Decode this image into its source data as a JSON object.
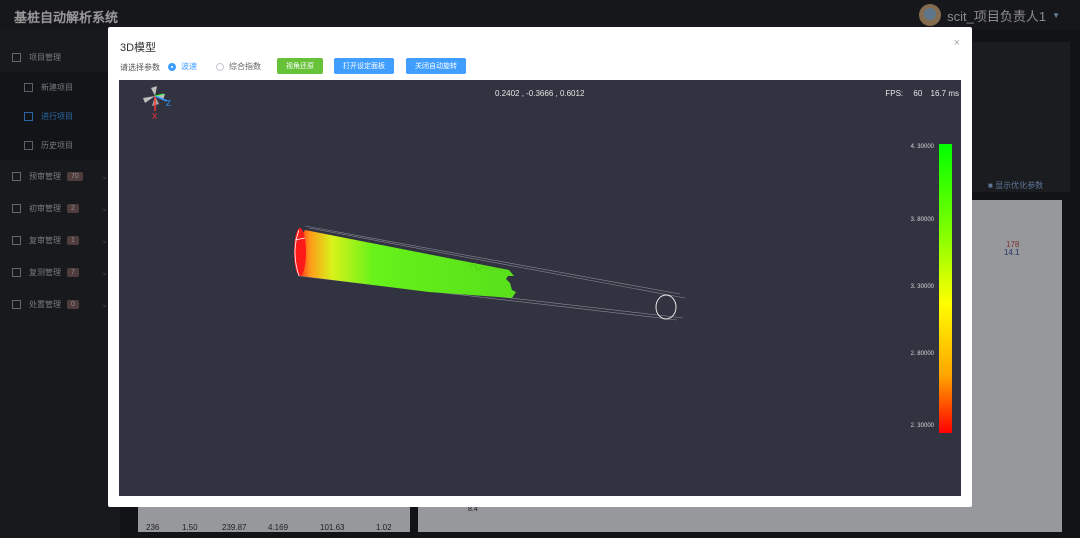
{
  "app": {
    "title": "基桩自动解析系统",
    "user": "scit_项目负责人1"
  },
  "sidebar": {
    "items": [
      {
        "label": "项目管理",
        "type": "group",
        "icon": "project-icon"
      },
      {
        "label": "新建项目",
        "type": "sub",
        "icon": "grid-icon"
      },
      {
        "label": "进行项目",
        "type": "sub",
        "icon": "tree-icon",
        "active": true
      },
      {
        "label": "历史项目",
        "type": "sub",
        "icon": "tree-icon"
      },
      {
        "label": "预审管理",
        "type": "group",
        "badge": "70"
      },
      {
        "label": "初审管理",
        "type": "group",
        "badge": "2"
      },
      {
        "label": "复审管理",
        "type": "group",
        "badge": "1"
      },
      {
        "label": "复测管理",
        "type": "group",
        "badge": "7"
      },
      {
        "label": "处置管理",
        "type": "group",
        "badge": "0"
      }
    ]
  },
  "background": {
    "show_optimize_label": "显示优化参数",
    "chart_values": [
      "178",
      "14.1"
    ],
    "table_row": [
      "236",
      "1.50",
      "239.87",
      "4.169",
      "101.63",
      "1.02"
    ],
    "axis_value": "8.4"
  },
  "dialog": {
    "title": "3D模型",
    "close_label": "×",
    "param_label": "请选择参数",
    "radios": [
      {
        "label": "波速",
        "checked": true
      },
      {
        "label": "综合指数",
        "checked": false
      }
    ],
    "buttons": [
      {
        "label": "视角还原",
        "style": "green"
      },
      {
        "label": "打开设定面板",
        "style": "blue"
      },
      {
        "label": "关闭自动旋转",
        "style": "blue"
      }
    ]
  },
  "viewer": {
    "coords": "0.2402 , -0.3666 , 0.6012",
    "fps_label": "FPS:",
    "fps_value": "60",
    "frame_time": "16.7 ms",
    "axis_labels": {
      "x": "X",
      "z": "Z"
    },
    "colorbar": {
      "labels": [
        "4. 30000",
        "3. 80000",
        "3. 30000",
        "2. 80000",
        "2. 30000"
      ],
      "colors": [
        "#00ff00",
        "#7fff00",
        "#ffff00",
        "#ffa500",
        "#ff0000"
      ]
    }
  }
}
